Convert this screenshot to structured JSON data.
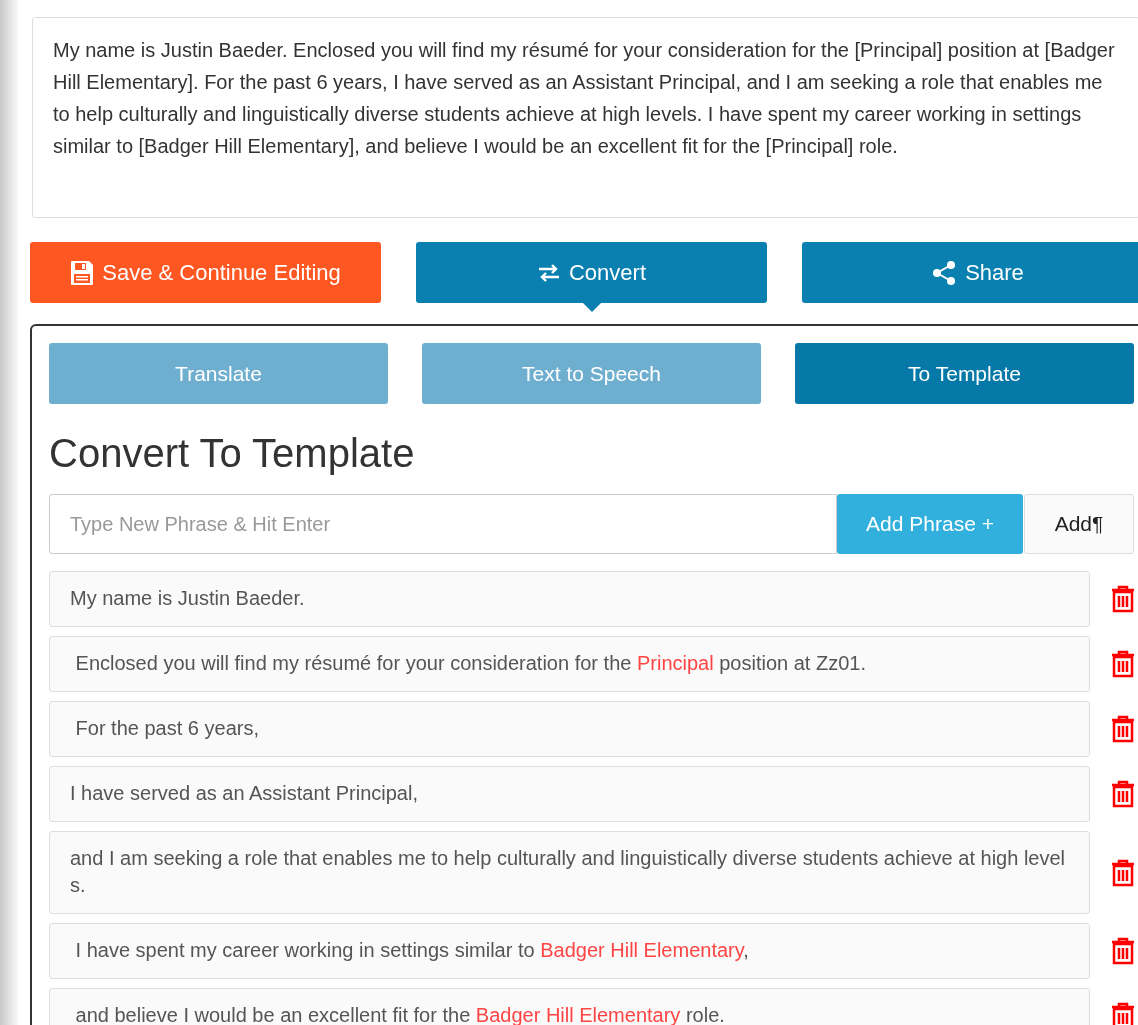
{
  "letter": {
    "text": "My name is Justin Baeder. Enclosed you will find my résumé for your consideration for the [Principal] position at [Badger Hill Elementary]. For the past 6 years, I have served as an Assistant Principal, and I am seeking a role that enables me to help culturally and linguistically diverse students achieve at high levels. I have spent my career working in settings similar to [Badger Hill Elementary], and believe I would be an excellent fit for the [Principal] role."
  },
  "actions": [
    {
      "kind": "save",
      "label": "Save & Continue Editing",
      "selected": false
    },
    {
      "kind": "convert",
      "label": "Convert",
      "selected": true
    },
    {
      "kind": "share",
      "label": "Share",
      "selected": false
    }
  ],
  "tabs": [
    {
      "label": "Translate",
      "selected": false
    },
    {
      "label": "Text to Speech",
      "selected": false
    },
    {
      "label": "To Template",
      "selected": true
    }
  ],
  "heading": "Convert To Template",
  "phrase_input": {
    "placeholder": "Type New Phrase & Hit Enter"
  },
  "add_phrase_button": "Add Phrase +",
  "add_paragraph_button": "Add¶",
  "phrases": [
    {
      "segments": [
        {
          "text": "My name is Justin Baeder.",
          "placeholder": false
        }
      ]
    },
    {
      "segments": [
        {
          "text": " Enclosed you will find my résumé for your consideration for the ",
          "placeholder": false
        },
        {
          "text": "Principal",
          "placeholder": true
        },
        {
          "text": " position at Zz01.",
          "placeholder": false
        }
      ]
    },
    {
      "segments": [
        {
          "text": " For the past 6 years,",
          "placeholder": false
        }
      ]
    },
    {
      "segments": [
        {
          "text": "I have served as an Assistant Principal,",
          "placeholder": false
        }
      ]
    },
    {
      "segments": [
        {
          "text": "and I am seeking a role that enables me to help culturally and linguistically diverse students achieve at high levels.",
          "placeholder": false
        }
      ]
    },
    {
      "segments": [
        {
          "text": " I have spent my career working in settings similar to ",
          "placeholder": false
        },
        {
          "text": "Badger Hill Elementary",
          "placeholder": true
        },
        {
          "text": ",",
          "placeholder": false
        }
      ]
    },
    {
      "segments": [
        {
          "text": " and believe I would be an excellent fit for the ",
          "placeholder": false
        },
        {
          "text": "Badger Hill Elementary",
          "placeholder": true
        },
        {
          "text": " role.",
          "placeholder": false
        }
      ]
    }
  ]
}
